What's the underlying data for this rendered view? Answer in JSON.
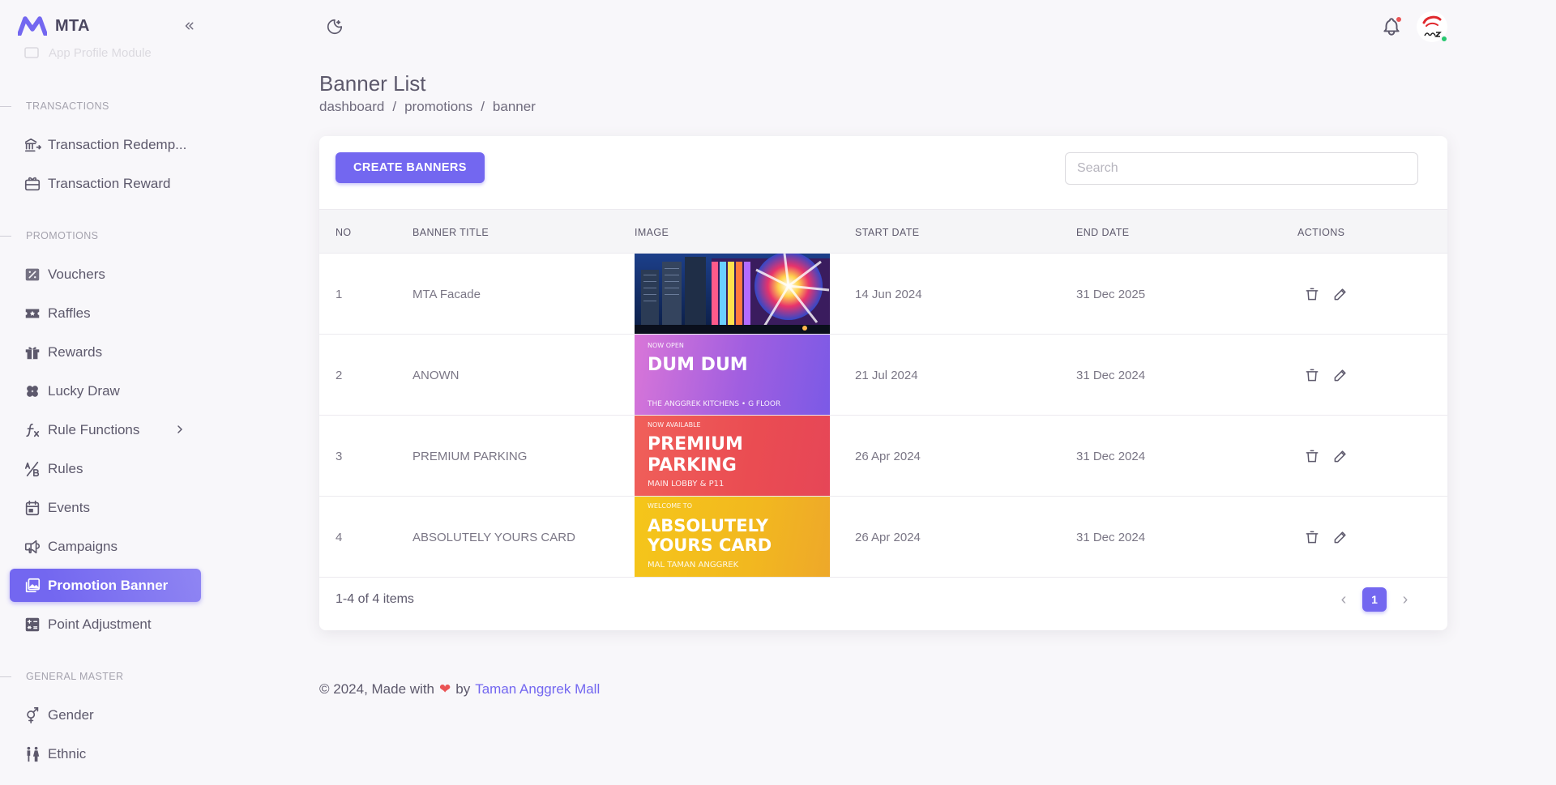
{
  "app": {
    "name": "MTA"
  },
  "sidebar": {
    "ghost_item": "App Profile Module",
    "sections": [
      {
        "header": "TRANSACTIONS",
        "items": [
          {
            "label": "Transaction Redemp...",
            "icon": "bank-transfer-icon"
          },
          {
            "label": "Transaction Reward",
            "icon": "gift-card-icon"
          }
        ]
      },
      {
        "header": "PROMOTIONS",
        "items": [
          {
            "label": "Vouchers",
            "icon": "discount-icon"
          },
          {
            "label": "Raffles",
            "icon": "ticket-star-icon"
          },
          {
            "label": "Rewards",
            "icon": "gift-icon"
          },
          {
            "label": "Lucky Draw",
            "icon": "clover-icon"
          },
          {
            "label": "Rule Functions",
            "icon": "function-icon"
          },
          {
            "label": "Rules",
            "icon": "ab-icon"
          },
          {
            "label": "Events",
            "icon": "calendar-event-icon"
          },
          {
            "label": "Campaigns",
            "icon": "speakerphone-icon"
          },
          {
            "label": "Promotion Banner",
            "icon": "photo-icon"
          },
          {
            "label": "Point Adjustment",
            "icon": "calculator-icon"
          }
        ]
      },
      {
        "header": "GENERAL MASTER",
        "items": [
          {
            "label": "Gender",
            "icon": "gender-icon"
          },
          {
            "label": "Ethnic",
            "icon": "users-icon"
          }
        ]
      }
    ]
  },
  "page": {
    "title": "Banner List",
    "breadcrumb": [
      "dashboard",
      "promotions",
      "banner"
    ],
    "breadcrumb_sep": "/"
  },
  "toolbar": {
    "create_label": "CREATE BANNERS",
    "search_placeholder": "Search"
  },
  "table": {
    "columns": [
      "NO",
      "BANNER TITLE",
      "IMAGE",
      "START DATE",
      "END DATE",
      "ACTIONS"
    ],
    "rows": [
      {
        "no": "1",
        "title": "MTA Facade",
        "start": "14 Jun 2024",
        "end": "31 Dec 2025"
      },
      {
        "no": "2",
        "title": "ANOWN",
        "start": "21 Jul 2024",
        "end": "31 Dec 2024"
      },
      {
        "no": "3",
        "title": "PREMIUM PARKING",
        "start": "26 Apr 2024",
        "end": "31 Dec 2024"
      },
      {
        "no": "4",
        "title": "ABSOLUTELY YOURS CARD",
        "start": "26 Apr 2024",
        "end": "31 Dec 2024"
      }
    ]
  },
  "banners": {
    "b2": {
      "kicker": "NOW OPEN",
      "title": "DUM DUM",
      "sub": "THE ANGGREK KITCHENS • G FLOOR"
    },
    "b3": {
      "kicker": "NOW AVAILABLE",
      "line1": "PREMIUM",
      "line2": "PARKING",
      "sub": "MAIN LOBBY & P11"
    },
    "b4": {
      "kicker": "WELCOME TO",
      "line1": "ABSOLUTELY",
      "line2": "YOURS CARD",
      "sub": "MAL TAMAN ANGGREK"
    }
  },
  "pagination": {
    "summary": "1-4 of 4 items",
    "current": "1",
    "prev": "‹",
    "next": "›"
  },
  "footer": {
    "prefix": "© 2024, Made with",
    "heart": "❤",
    "by": "by",
    "link": "Taman Anggrek Mall"
  },
  "colors": {
    "primary": "#7367f0",
    "danger": "#ea5455",
    "success": "#28c76f",
    "text": "#5d596c"
  }
}
